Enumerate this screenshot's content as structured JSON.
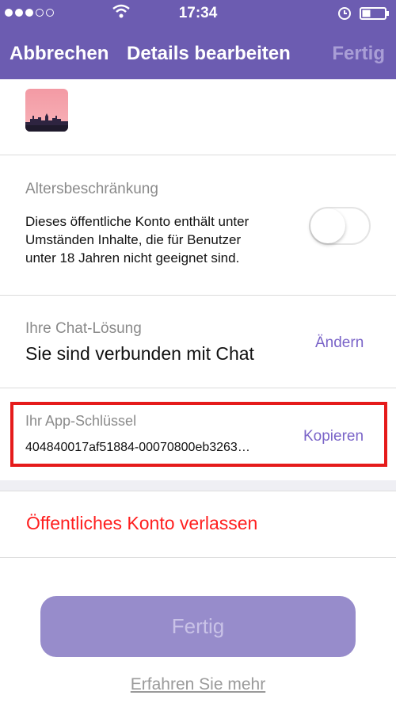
{
  "status_bar": {
    "time": "17:34"
  },
  "nav": {
    "cancel": "Abbrechen",
    "title": "Details bearbeiten",
    "done": "Fertig"
  },
  "age_restriction": {
    "title": "Altersbeschränkung",
    "description_lines": [
      "Dieses öffentliche Konto enthält unter",
      "Umständen Inhalte, die für Benutzer",
      "unter 18 Jahren nicht geeignet sind."
    ],
    "toggle_on": false
  },
  "chat_solution": {
    "label": "Ihre Chat-Lösung",
    "value": "Sie sind verbunden mit Chat",
    "action": "Ändern"
  },
  "app_key": {
    "label": "Ihr App-Schlüssel",
    "value": "404840017af51884-00070800eb3263…",
    "action": "Kopieren"
  },
  "leave_account": "Öffentliches Konto verlassen",
  "done_button": "Fertig",
  "learn_more": "Erfahren Sie mehr",
  "colors": {
    "header": "#6c5cb1",
    "accent": "#7a64c8",
    "danger": "#ff1f1f",
    "highlight_box": "#e51b1b"
  }
}
